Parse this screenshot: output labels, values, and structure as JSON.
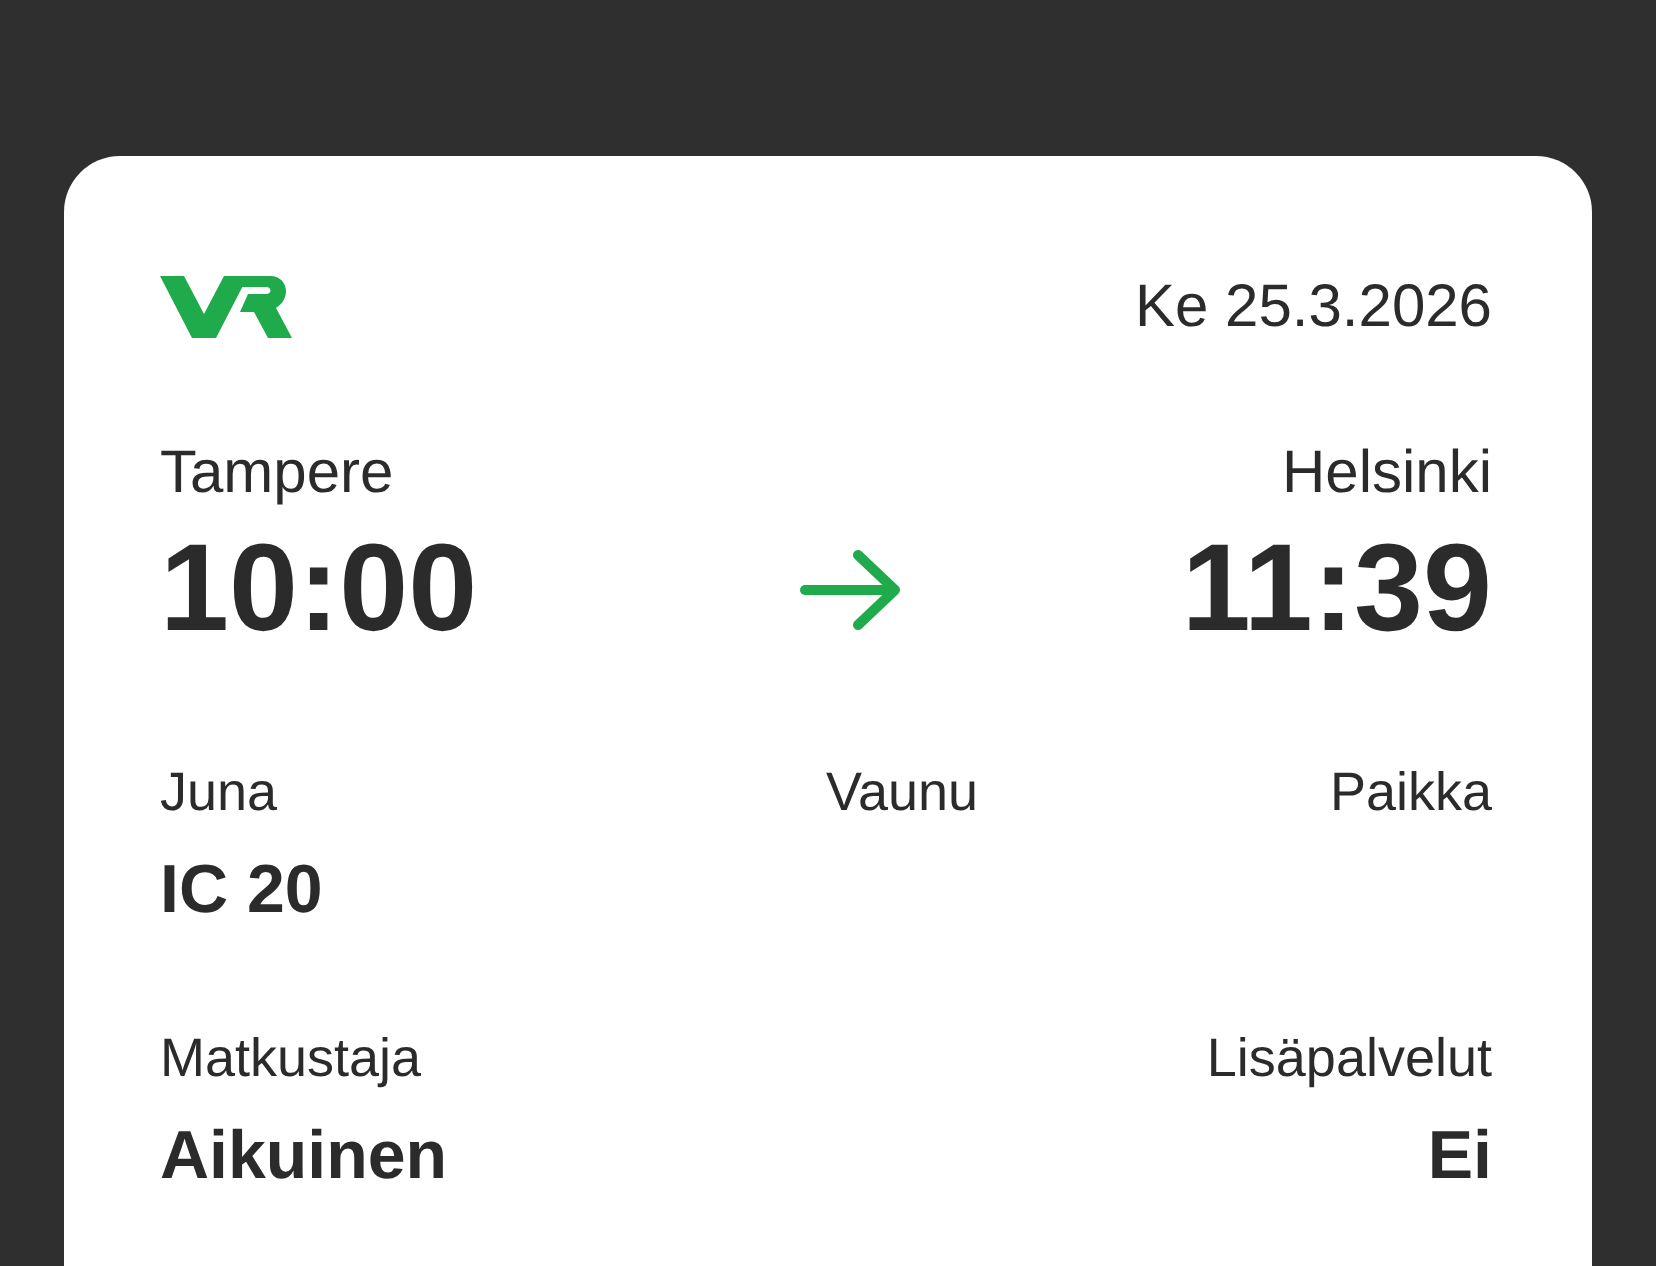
{
  "header": {
    "date": "Ke 25.3.2026"
  },
  "journey": {
    "departure": {
      "station": "Tampere",
      "time": "10:00"
    },
    "arrival": {
      "station": "Helsinki",
      "time": "11:39"
    }
  },
  "details": {
    "train": {
      "label": "Juna",
      "value": "IC 20"
    },
    "carriage": {
      "label": "Vaunu"
    },
    "seat": {
      "label": "Paikka"
    }
  },
  "booking": {
    "passenger": {
      "label": "Matkustaja",
      "value": "Aikuinen"
    },
    "extras": {
      "label": "Lisäpalvelut",
      "value": "Ei"
    }
  }
}
